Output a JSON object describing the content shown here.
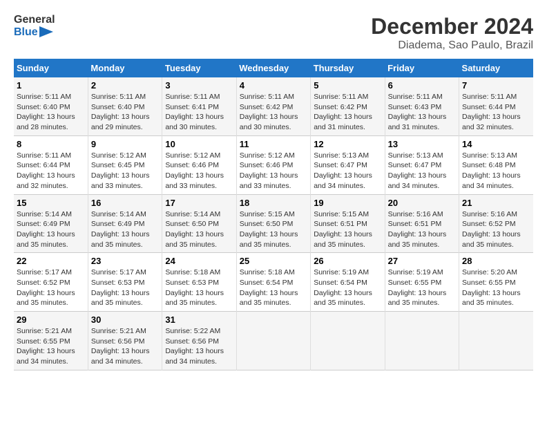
{
  "header": {
    "logo_line1": "General",
    "logo_line2": "Blue",
    "month": "December 2024",
    "location": "Diadema, Sao Paulo, Brazil"
  },
  "weekdays": [
    "Sunday",
    "Monday",
    "Tuesday",
    "Wednesday",
    "Thursday",
    "Friday",
    "Saturday"
  ],
  "weeks": [
    [
      {
        "day": "1",
        "sunrise": "5:11 AM",
        "sunset": "6:40 PM",
        "daylight": "13 hours and 28 minutes."
      },
      {
        "day": "2",
        "sunrise": "5:11 AM",
        "sunset": "6:40 PM",
        "daylight": "13 hours and 29 minutes."
      },
      {
        "day": "3",
        "sunrise": "5:11 AM",
        "sunset": "6:41 PM",
        "daylight": "13 hours and 30 minutes."
      },
      {
        "day": "4",
        "sunrise": "5:11 AM",
        "sunset": "6:42 PM",
        "daylight": "13 hours and 30 minutes."
      },
      {
        "day": "5",
        "sunrise": "5:11 AM",
        "sunset": "6:42 PM",
        "daylight": "13 hours and 31 minutes."
      },
      {
        "day": "6",
        "sunrise": "5:11 AM",
        "sunset": "6:43 PM",
        "daylight": "13 hours and 31 minutes."
      },
      {
        "day": "7",
        "sunrise": "5:11 AM",
        "sunset": "6:44 PM",
        "daylight": "13 hours and 32 minutes."
      }
    ],
    [
      {
        "day": "8",
        "sunrise": "5:11 AM",
        "sunset": "6:44 PM",
        "daylight": "13 hours and 32 minutes."
      },
      {
        "day": "9",
        "sunrise": "5:12 AM",
        "sunset": "6:45 PM",
        "daylight": "13 hours and 33 minutes."
      },
      {
        "day": "10",
        "sunrise": "5:12 AM",
        "sunset": "6:46 PM",
        "daylight": "13 hours and 33 minutes."
      },
      {
        "day": "11",
        "sunrise": "5:12 AM",
        "sunset": "6:46 PM",
        "daylight": "13 hours and 33 minutes."
      },
      {
        "day": "12",
        "sunrise": "5:13 AM",
        "sunset": "6:47 PM",
        "daylight": "13 hours and 34 minutes."
      },
      {
        "day": "13",
        "sunrise": "5:13 AM",
        "sunset": "6:47 PM",
        "daylight": "13 hours and 34 minutes."
      },
      {
        "day": "14",
        "sunrise": "5:13 AM",
        "sunset": "6:48 PM",
        "daylight": "13 hours and 34 minutes."
      }
    ],
    [
      {
        "day": "15",
        "sunrise": "5:14 AM",
        "sunset": "6:49 PM",
        "daylight": "13 hours and 35 minutes."
      },
      {
        "day": "16",
        "sunrise": "5:14 AM",
        "sunset": "6:49 PM",
        "daylight": "13 hours and 35 minutes."
      },
      {
        "day": "17",
        "sunrise": "5:14 AM",
        "sunset": "6:50 PM",
        "daylight": "13 hours and 35 minutes."
      },
      {
        "day": "18",
        "sunrise": "5:15 AM",
        "sunset": "6:50 PM",
        "daylight": "13 hours and 35 minutes."
      },
      {
        "day": "19",
        "sunrise": "5:15 AM",
        "sunset": "6:51 PM",
        "daylight": "13 hours and 35 minutes."
      },
      {
        "day": "20",
        "sunrise": "5:16 AM",
        "sunset": "6:51 PM",
        "daylight": "13 hours and 35 minutes."
      },
      {
        "day": "21",
        "sunrise": "5:16 AM",
        "sunset": "6:52 PM",
        "daylight": "13 hours and 35 minutes."
      }
    ],
    [
      {
        "day": "22",
        "sunrise": "5:17 AM",
        "sunset": "6:52 PM",
        "daylight": "13 hours and 35 minutes."
      },
      {
        "day": "23",
        "sunrise": "5:17 AM",
        "sunset": "6:53 PM",
        "daylight": "13 hours and 35 minutes."
      },
      {
        "day": "24",
        "sunrise": "5:18 AM",
        "sunset": "6:53 PM",
        "daylight": "13 hours and 35 minutes."
      },
      {
        "day": "25",
        "sunrise": "5:18 AM",
        "sunset": "6:54 PM",
        "daylight": "13 hours and 35 minutes."
      },
      {
        "day": "26",
        "sunrise": "5:19 AM",
        "sunset": "6:54 PM",
        "daylight": "13 hours and 35 minutes."
      },
      {
        "day": "27",
        "sunrise": "5:19 AM",
        "sunset": "6:55 PM",
        "daylight": "13 hours and 35 minutes."
      },
      {
        "day": "28",
        "sunrise": "5:20 AM",
        "sunset": "6:55 PM",
        "daylight": "13 hours and 35 minutes."
      }
    ],
    [
      {
        "day": "29",
        "sunrise": "5:21 AM",
        "sunset": "6:55 PM",
        "daylight": "13 hours and 34 minutes."
      },
      {
        "day": "30",
        "sunrise": "5:21 AM",
        "sunset": "6:56 PM",
        "daylight": "13 hours and 34 minutes."
      },
      {
        "day": "31",
        "sunrise": "5:22 AM",
        "sunset": "6:56 PM",
        "daylight": "13 hours and 34 minutes."
      },
      null,
      null,
      null,
      null
    ]
  ],
  "labels": {
    "sunrise": "Sunrise:",
    "sunset": "Sunset:",
    "daylight": "Daylight:"
  }
}
